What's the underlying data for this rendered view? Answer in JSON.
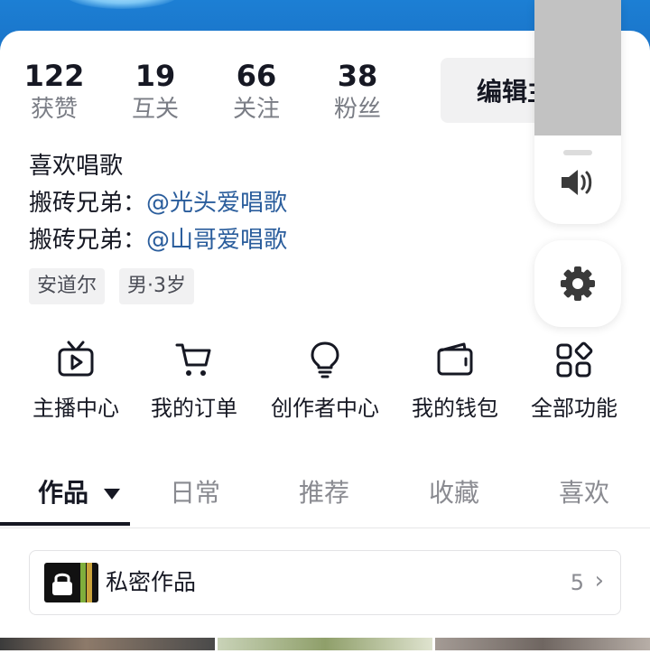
{
  "stats": [
    {
      "value": "122",
      "label": "获赞"
    },
    {
      "value": "19",
      "label": "互关"
    },
    {
      "value": "66",
      "label": "关注"
    },
    {
      "value": "38",
      "label": "粉丝"
    }
  ],
  "edit_button_label": "编辑主页",
  "bio": {
    "line1": "喜欢唱歌",
    "line2_prefix": "搬砖兄弟：",
    "line2_mention": "@光头爱唱歌",
    "line3_prefix": "搬砖兄弟：",
    "line3_mention": "@山哥爱唱歌"
  },
  "tags": [
    "安道尔",
    "男·3岁"
  ],
  "features": [
    {
      "label": "主播中心",
      "icon": "tv-play-icon"
    },
    {
      "label": "我的订单",
      "icon": "cart-icon"
    },
    {
      "label": "创作者中心",
      "icon": "lightbulb-icon"
    },
    {
      "label": "我的钱包",
      "icon": "wallet-icon"
    },
    {
      "label": "全部功能",
      "icon": "grid-icon"
    }
  ],
  "tabs": [
    {
      "label": "作品",
      "active": true
    },
    {
      "label": "日常"
    },
    {
      "label": "推荐"
    },
    {
      "label": "收藏"
    },
    {
      "label": "喜欢"
    }
  ],
  "private_works": {
    "label": "私密作品",
    "count": "5"
  },
  "volume": {
    "level": 0.6
  },
  "colors": {
    "mention": "#2a5d9c",
    "banner": "#1a73c8",
    "text": "#161823",
    "muted": "#8a8b91"
  }
}
